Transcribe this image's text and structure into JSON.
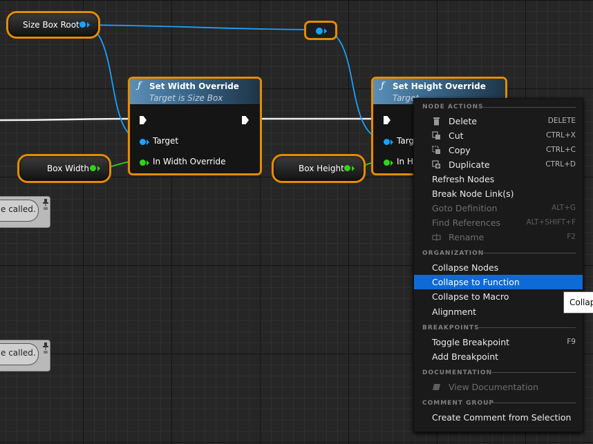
{
  "graph": {
    "size_box_root": {
      "label": "Size Box Root"
    },
    "box_width": {
      "label": "Box Width"
    },
    "box_height": {
      "label": "Box Height"
    },
    "set_width": {
      "title": "Set Width Override",
      "subtitle": "Target is Size Box",
      "pins": [
        "Target",
        "In Width Override"
      ]
    },
    "set_height": {
      "title": "Set Height Override",
      "subtitle": "Target",
      "pins": [
        "Targ",
        "In He"
      ]
    },
    "comments": [
      {
        "text": "e called."
      },
      {
        "text": "e called."
      }
    ]
  },
  "context_menu": {
    "sections": {
      "node_actions": "NODE ACTIONS",
      "organization": "ORGANIZATION",
      "breakpoints": "BREAKPOINTS",
      "documentation": "DOCUMENTATION",
      "comment_group": "COMMENT GROUP"
    },
    "items": {
      "delete": {
        "label": "Delete",
        "shortcut": "DELETE"
      },
      "cut": {
        "label": "Cut",
        "shortcut": "CTRL+X"
      },
      "copy": {
        "label": "Copy",
        "shortcut": "CTRL+C"
      },
      "duplicate": {
        "label": "Duplicate",
        "shortcut": "CTRL+D"
      },
      "refresh": {
        "label": "Refresh Nodes"
      },
      "break_links": {
        "label": "Break Node Link(s)"
      },
      "goto_def": {
        "label": "Goto Definition",
        "shortcut": "ALT+G"
      },
      "find_refs": {
        "label": "Find References",
        "shortcut": "ALT+SHIFT+F"
      },
      "rename": {
        "label": "Rename",
        "shortcut": "F2"
      },
      "collapse_nodes": {
        "label": "Collapse Nodes"
      },
      "collapse_function": {
        "label": "Collapse to Function"
      },
      "collapse_macro": {
        "label": "Collapse to Macro"
      },
      "alignment": {
        "label": "Alignment"
      },
      "toggle_bp": {
        "label": "Toggle Breakpoint",
        "shortcut": "F9"
      },
      "add_bp": {
        "label": "Add Breakpoint"
      },
      "view_doc": {
        "label": "View Documentation"
      },
      "create_comment": {
        "label": "Create Comment from Selection"
      }
    },
    "selected_item": "Collapse to Function"
  },
  "tooltip": {
    "text": "Collap"
  },
  "colors": {
    "object_pin": "#1aa2ff",
    "float_pin": "#34d11d",
    "selection": "#e58c00",
    "menu_highlight": "#0e6ad7"
  }
}
